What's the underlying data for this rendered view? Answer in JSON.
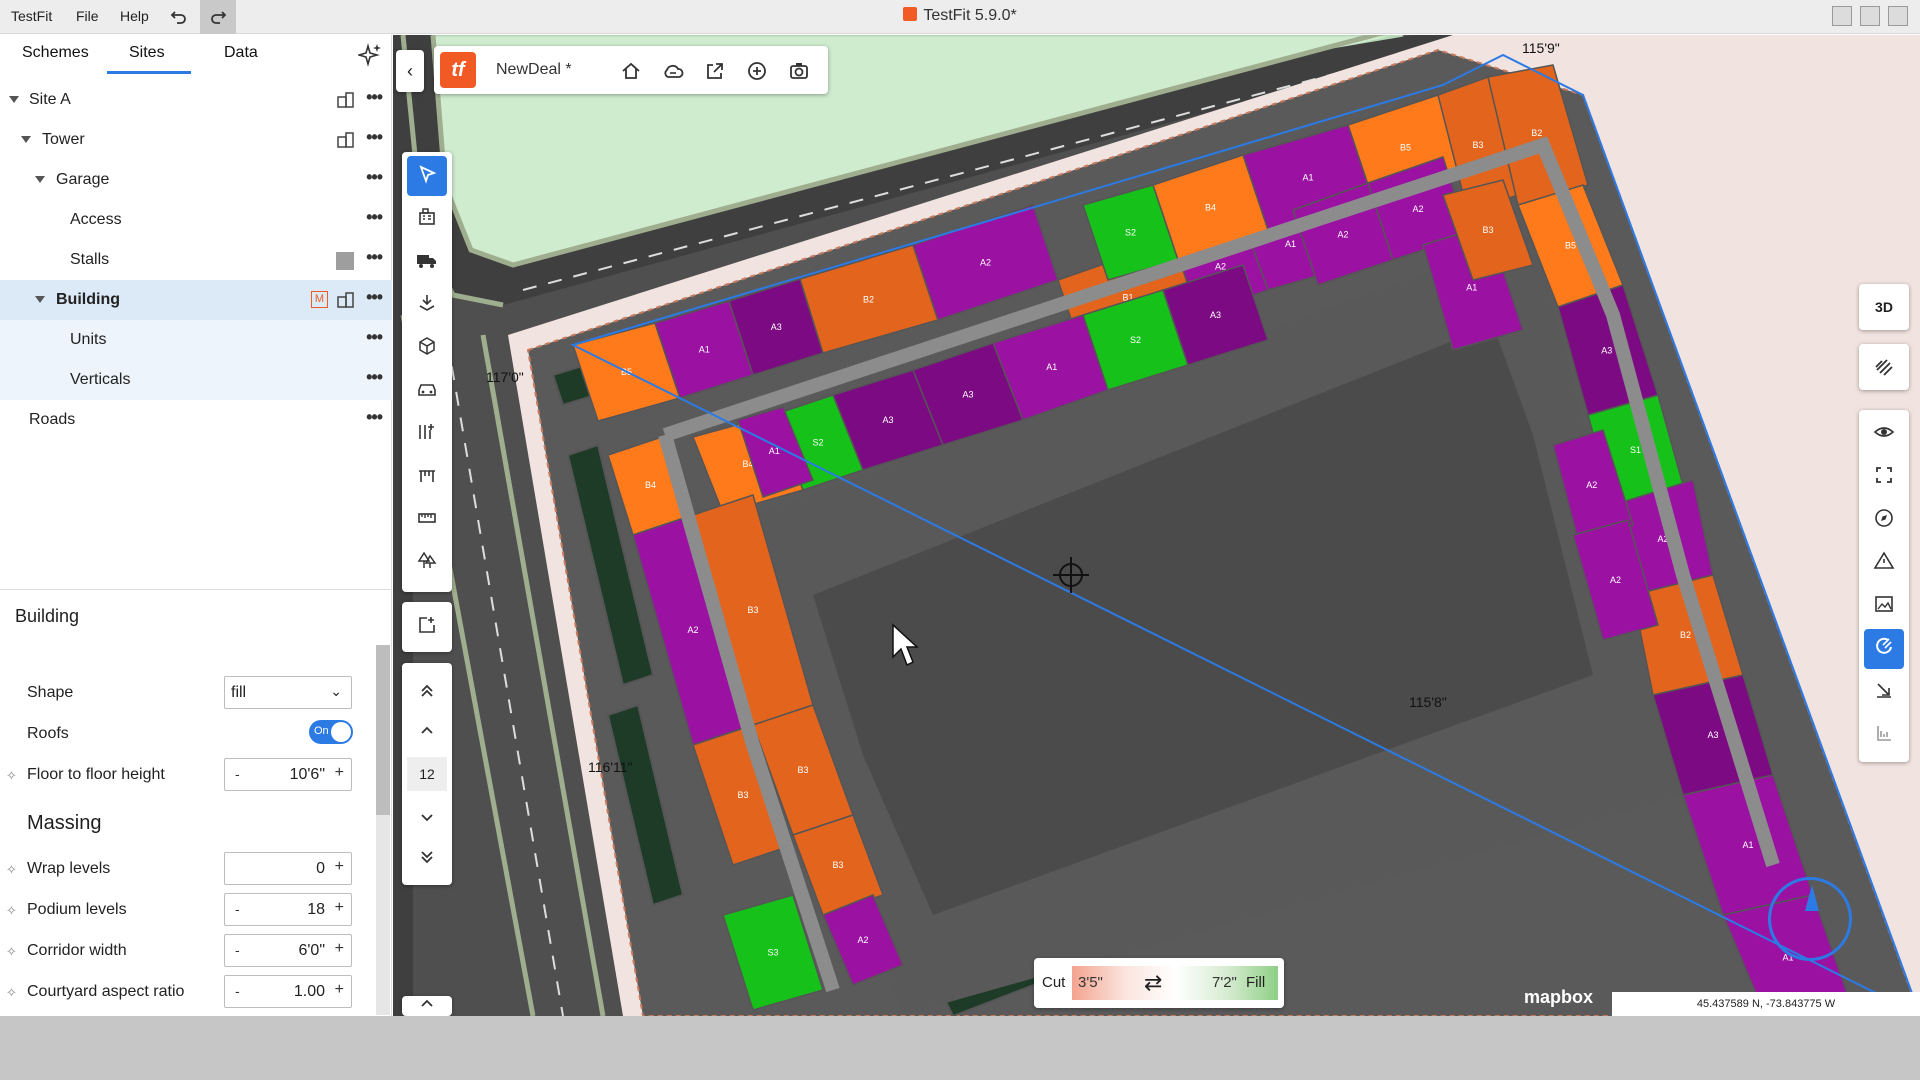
{
  "titlebar": {
    "menu": [
      "TestFit",
      "File",
      "Help"
    ],
    "app_title": "TestFit 5.9.0*"
  },
  "left_panel": {
    "tabs": [
      "Schemes",
      "Sites",
      "Data"
    ],
    "active_tab": "Sites",
    "tree": [
      {
        "label": "Site A",
        "level": 0,
        "expanded": true,
        "icon": "building-icon"
      },
      {
        "label": "Tower",
        "level": 1,
        "expanded": true,
        "icon": "building-icon"
      },
      {
        "label": "Garage",
        "level": 2,
        "expanded": true
      },
      {
        "label": "Access",
        "level": 3
      },
      {
        "label": "Stalls",
        "level": 3,
        "swatch": "#9e9e9e"
      },
      {
        "label": "Building",
        "level": 2,
        "expanded": true,
        "selected": true,
        "badge": "M"
      },
      {
        "label": "Units",
        "level": 3
      },
      {
        "label": "Verticals",
        "level": 3
      },
      {
        "label": "Roads",
        "level": 0
      }
    ],
    "section_title": "Building",
    "props": {
      "shape": {
        "label": "Shape",
        "value": "fill"
      },
      "roofs": {
        "label": "Roofs",
        "value": "On"
      },
      "floor_to_floor": {
        "label": "Floor to floor height",
        "minus": "-",
        "value": "10'6\"",
        "plus": "+"
      }
    },
    "massing": {
      "title": "Massing",
      "wrap_levels": {
        "label": "Wrap levels",
        "value": "0",
        "plus": "+"
      },
      "podium_levels": {
        "label": "Podium levels",
        "minus": "-",
        "value": "18",
        "plus": "+"
      },
      "corridor_width": {
        "label": "Corridor width",
        "minus": "-",
        "value": "6'0\"",
        "plus": "+"
      },
      "courtyard_aspect_ratio": {
        "label": "Courtyard aspect ratio",
        "minus": "-",
        "value": "1.00",
        "plus": "+"
      }
    }
  },
  "project": {
    "logo_text": "tf",
    "name": "NewDeal *"
  },
  "level": {
    "current": "12"
  },
  "right_tools": {
    "mode_3d": "3D"
  },
  "cut_fill": {
    "cut_label": "Cut",
    "cut_value": "3'5\"",
    "fill_value": "7'2\"",
    "fill_label": "Fill"
  },
  "map": {
    "elevations": [
      "115'9\"",
      "117'0\"",
      "116'11\"",
      "115'8\""
    ],
    "attribution": "mapbox",
    "coordinates": "45.437589 N, -73.843775 W"
  },
  "units": [
    "B5",
    "A1",
    "A3",
    "B2",
    "A2",
    "B1",
    "A2",
    "A1",
    "B4",
    "S2",
    "A3",
    "A3",
    "A1",
    "S2",
    "A3",
    "B5",
    "A1",
    "B4",
    "S2",
    "A2",
    "A2",
    "B3",
    "B2",
    "B5",
    "A1",
    "A3",
    "S1",
    "A2",
    "B2",
    "A3",
    "A1",
    "A1",
    "B4",
    "A2",
    "B3",
    "B3",
    "B3",
    "B3",
    "A2",
    "S3",
    "A1",
    "B3",
    "A2",
    "A2"
  ]
}
